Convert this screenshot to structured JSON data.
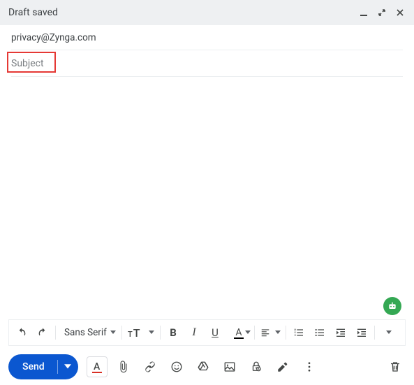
{
  "header": {
    "title": "Draft saved"
  },
  "recipients": {
    "to": "privacy@Zynga.com"
  },
  "subject": {
    "placeholder": "Subject",
    "value": ""
  },
  "format_toolbar": {
    "font": "Sans Serif",
    "size_label_big": "T",
    "size_label_small": "T",
    "bold": "B",
    "italic": "I",
    "underline": "U",
    "text_color": "A"
  },
  "bottom": {
    "send": "Send",
    "text_color": "A"
  },
  "icons": {
    "minimize": "minimize",
    "popout": "popout",
    "close": "close",
    "undo": "undo",
    "redo": "redo",
    "align": "align",
    "list_num": "numbered-list",
    "list_bul": "bulleted-list",
    "indent_less": "indent-decrease",
    "indent_more": "indent-increase",
    "more_format": "more-formatting",
    "attach": "attach",
    "link": "link",
    "emoji": "emoji",
    "drive": "drive",
    "image": "image",
    "confidential": "confidential",
    "signature": "signature",
    "more": "more",
    "trash": "trash",
    "assistant": "assistant"
  }
}
